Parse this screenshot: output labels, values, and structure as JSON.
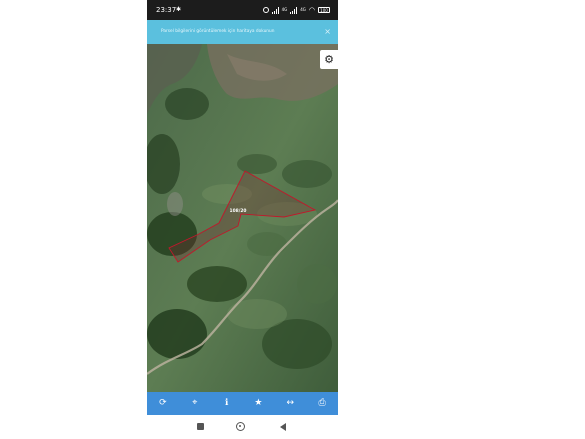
{
  "status_bar": {
    "time": "23:37",
    "indicator": "✱",
    "network_1": "4G",
    "network_2": "4G",
    "battery": "100",
    "icons": [
      "alarm-icon",
      "signal-icon",
      "signal-icon",
      "wifi-icon",
      "battery-icon"
    ]
  },
  "banner": {
    "text": "Parsel bilgilerini görüntülemek için haritaya dokunun",
    "close": "×",
    "color": "#5bc0de"
  },
  "map": {
    "parcel_label": "108/20",
    "parcel_outline_color": "#c0182b",
    "settings_icon": "gear-icon"
  },
  "toolbar": {
    "color": "#3f8ed9",
    "buttons": [
      {
        "icon": "refresh-icon",
        "glyph": "⟳"
      },
      {
        "icon": "locate-icon",
        "glyph": "⌖"
      },
      {
        "icon": "info-icon",
        "glyph": "ℹ"
      },
      {
        "icon": "star-icon",
        "glyph": "★"
      },
      {
        "icon": "measure-icon",
        "glyph": "↔"
      },
      {
        "icon": "print-icon",
        "glyph": "⎙"
      }
    ]
  },
  "nav_bar": {
    "icons": [
      "recents-icon",
      "home-icon",
      "back-icon"
    ]
  }
}
